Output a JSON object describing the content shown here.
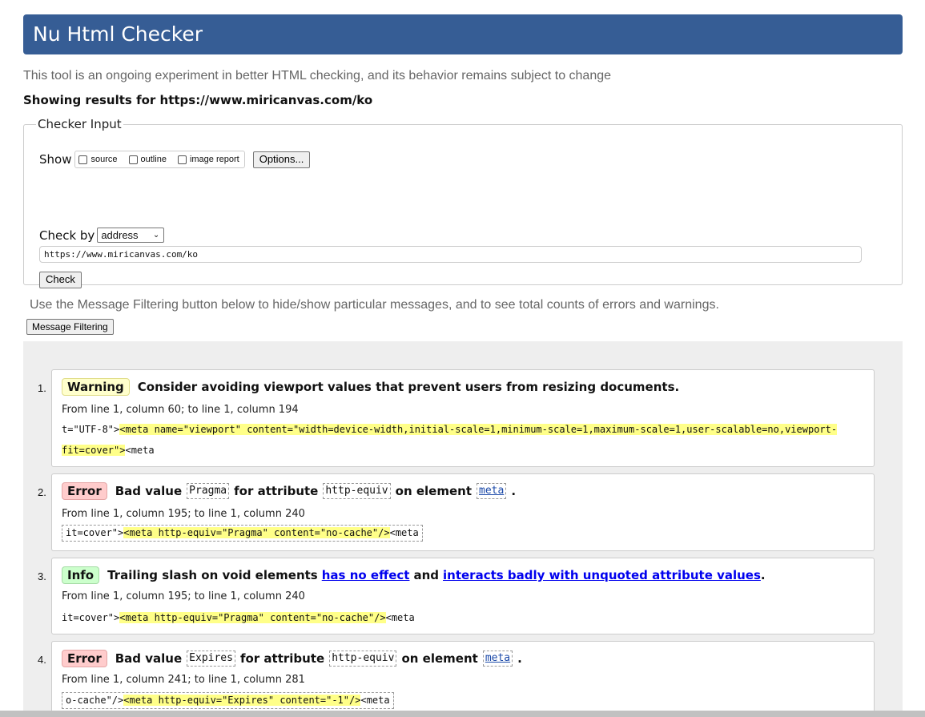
{
  "header": {
    "title": "Nu Html Checker"
  },
  "intro": "This tool is an ongoing experiment in better HTML checking, and its behavior remains subject to change",
  "showing": "Showing results for https://www.miricanvas.com/ko",
  "checker": {
    "legend": "Checker Input",
    "show_label": "Show",
    "show_options": [
      "source",
      "outline",
      "image report"
    ],
    "options_button": "Options...",
    "checkby_label": "Check by",
    "checkby_value": "address",
    "url": "https://www.miricanvas.com/ko",
    "check_button": "Check"
  },
  "filter_note": "Use the Message Filtering button below to hide/show particular messages, and to see total counts of errors and warnings.",
  "filter_button": "Message Filtering",
  "messages": [
    {
      "num": "1.",
      "type": "Warning",
      "text": "Consider avoiding viewport values that prevent users from resizing documents.",
      "location": "From line 1, column 60; to line 1, column 194",
      "extract_pre": "t=\"UTF-8\">",
      "extract_hl_1": "<meta name=\"viewport\" content=\"width=device-width,initial-scale=1,minimum-scale=1,maximum-scale=1,user-scalable=no,viewport-",
      "extract_hl_2": "fit=cover\">",
      "extract_post": "<meta"
    },
    {
      "num": "2.",
      "type": "Error",
      "p1": "Bad value",
      "code1": "Pragma",
      "p2": "for attribute",
      "code2": "http-equiv",
      "p3": "on element",
      "code3": "meta",
      "p4": ".",
      "location": "From line 1, column 195; to line 1, column 240",
      "extract_pre": "it=cover\">",
      "extract_hl": "<meta http-equiv=\"Pragma\" content=\"no-cache\"/>",
      "extract_post": "<meta"
    },
    {
      "num": "3.",
      "type": "Info",
      "p1": "Trailing slash on void elements",
      "link1": "has no effect",
      "p2": "and",
      "link2": "interacts badly with unquoted attribute values",
      "p3": ".",
      "location": "From line 1, column 195; to line 1, column 240",
      "extract_pre": "it=cover\">",
      "extract_hl": "<meta http-equiv=\"Pragma\" content=\"no-cache\"/>",
      "extract_post": "<meta"
    },
    {
      "num": "4.",
      "type": "Error",
      "p1": "Bad value",
      "code1": "Expires",
      "p2": "for attribute",
      "code2": "http-equiv",
      "p3": "on element",
      "code3": "meta",
      "p4": ".",
      "location": "From line 1, column 241; to line 1, column 281",
      "extract_pre": "o-cache\"/>",
      "extract_hl": "<meta http-equiv=\"Expires\" content=\"-1\"/>",
      "extract_post": "<meta"
    }
  ]
}
